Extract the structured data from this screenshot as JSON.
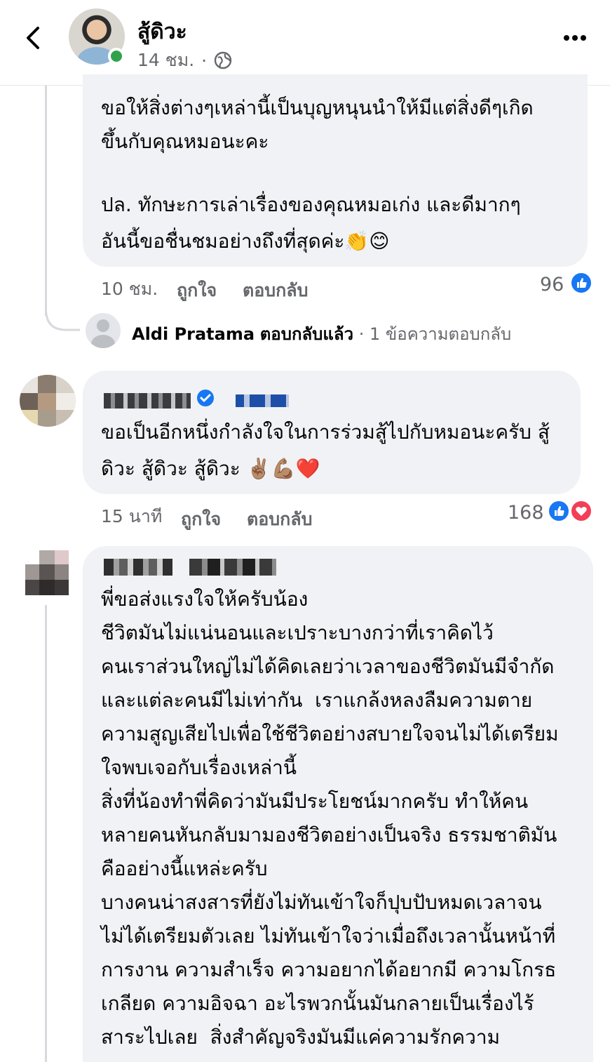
{
  "header": {
    "page_name": "สู้ดิวะ",
    "time": "14 ชม.",
    "separator": "·",
    "privacy_icon": "globe-icon",
    "back_icon": "chevron-left-icon",
    "more_icon": "more-horizontal-icon"
  },
  "comment1": {
    "lines": [
      "ขอให้สิ่งต่างๆเหล่านี้เป็นบุญหนุนนำให้มีแต่สิ่งดีๆเกิด",
      "ขึ้นกับคุณหมอนะคะ",
      "",
      "ปล. ทักษะการเล่าเรื่องของคุณหมอเก่ง และดีมากๆ",
      "อันนี้ขอชื่นชมอย่างถึงที่สุดค่ะ👏😊"
    ],
    "time": "10 ชม.",
    "like_label": "ถูกใจ",
    "reply_label": "ตอบกลับ",
    "reaction_count": "96",
    "reply_summary": {
      "name": "Aldi Pratama",
      "action": "ตอบกลับแล้ว",
      "separator": "·",
      "count_text": "1 ข้อความตอบกลับ"
    }
  },
  "comment2": {
    "lines": [
      "ขอเป็นอีกหนึ่งกำลังใจในการร่วมสู้ไปกับหมอนะครับ สู้",
      "ดิวะ สู้ดิวะ สู้ดิวะ ✌🏽💪🏽❤️"
    ],
    "time": "15 นาที",
    "like_label": "ถูกใจ",
    "reply_label": "ตอบกลับ",
    "reaction_count": "168"
  },
  "comment3": {
    "lines": [
      "พี่ขอส่งแรงใจให้ครับน้อง",
      "ชีวิตมันไม่แน่นอนและเปราะบางกว่าที่เราคิดไว้",
      "คนเราส่วนใหญ่ไม่ได้คิดเลยว่าเวลาของชีวิตมันมีจำกัด",
      "และแต่ละคนมีไม่เท่ากัน  เราแกล้งหลงลืมความตาย",
      "ความสูญเสียไปเพื่อใช้ชีวิตอย่างสบายใจจนไม่ได้เตรียม",
      "ใจพบเจอกับเรื่องเหล่านี้",
      "สิ่งที่น้องทำพี่คิดว่ามันมีประโยชน์มากครับ ทำให้คน",
      "หลายคนหันกลับมามองชีวิตอย่างเป็นจริง ธรรมชาติมัน",
      "คืออย่างนี้แหล่ะครับ",
      "บางคนน่าสงสารที่ยังไม่ทันเข้าใจก็ปุบปับหมดเวลาจน",
      "ไม่ได้เตรียมตัวเลย ไม่ทันเข้าใจว่าเมื่อถึงเวลานั้นหน้าที่",
      "การงาน ความสำเร็จ ความอยากได้อยากมี ความโกรธ",
      "เกลียด ความอิจฉา อะไรพวกนั้นมันกลายเป็นเรื่องไร้",
      "สาระไปเลย  สิ่งสำคัญจริงมันมีแค่ความรักความ"
    ]
  },
  "colors": {
    "bubble": "#f0f2f5",
    "secondary_text": "#65676b",
    "like": "#1877f2",
    "love": "#f33e58",
    "online": "#31a24c",
    "verified": "#1877f2"
  }
}
